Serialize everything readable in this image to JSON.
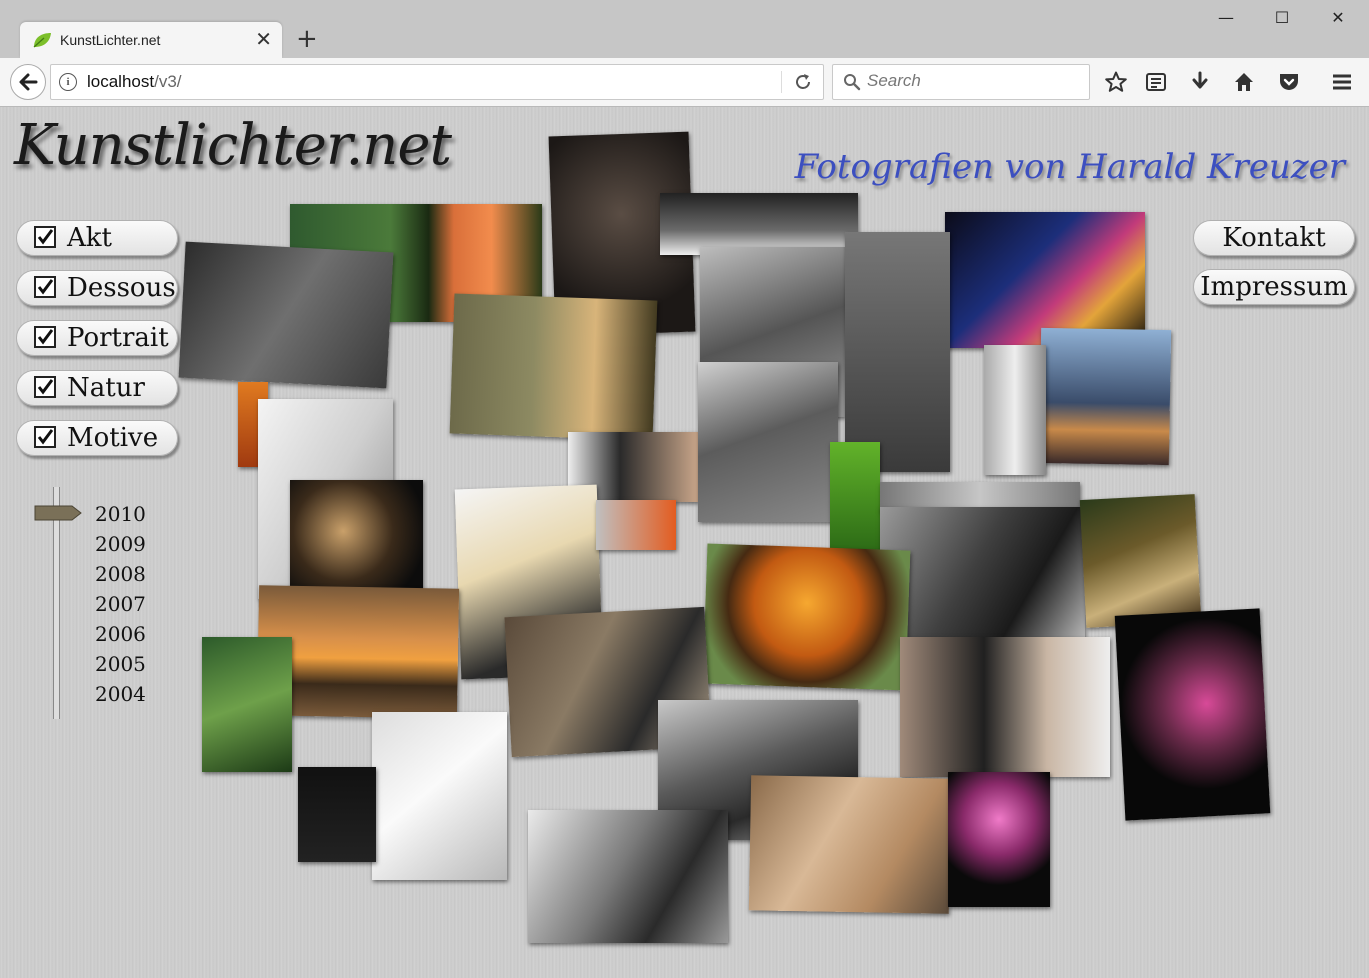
{
  "browser": {
    "tab_title": "KunstLichter.net",
    "tab_close": "✕",
    "new_tab": "+",
    "url_host": "localhost",
    "url_path": "/v3/",
    "search_placeholder": "Search",
    "window_controls": [
      "—",
      "☐",
      "✕"
    ]
  },
  "site": {
    "logo": "Kunstlichter.net",
    "subtitle": "Fotografien von Harald Kreuzer",
    "categories": [
      {
        "label": "Akt",
        "checked": true
      },
      {
        "label": "Dessous",
        "checked": true
      },
      {
        "label": "Portrait",
        "checked": true
      },
      {
        "label": "Natur",
        "checked": true
      },
      {
        "label": "Motive",
        "checked": true
      }
    ],
    "nav": {
      "contact": "Kontakt",
      "imprint": "Impressum"
    },
    "years": [
      "2010",
      "2009",
      "2008",
      "2007",
      "2006",
      "2005",
      "2004"
    ],
    "selected_year": "2010"
  }
}
